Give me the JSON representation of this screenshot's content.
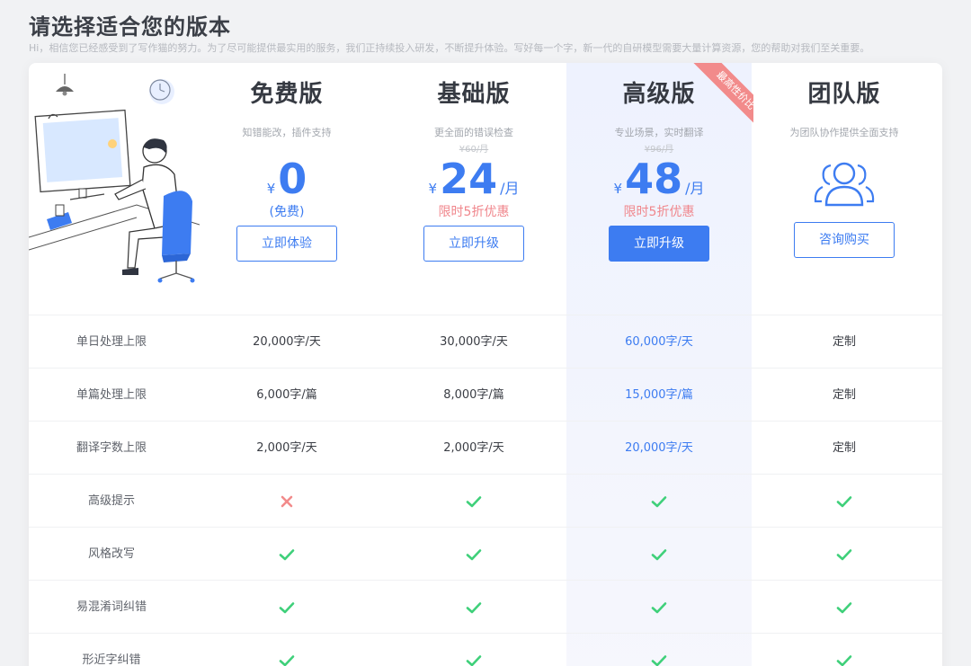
{
  "page": {
    "title": "请选择适合您的版本",
    "subtitle": "Hi，相信您已经感受到了写作猫的努力。为了尽可能提供最实用的服务，我们正持续投入研发，不断提升体验。写好每一个字，新一代的自研模型需要大量计算资源，您的帮助对我们至关重要。"
  },
  "colors": {
    "accent": "#3d7cf1",
    "ribbon": "#f28b8b",
    "check": "#3fd07a",
    "cross": "#f28b8b"
  },
  "ribbon": {
    "text": "最高性价比"
  },
  "plans": [
    {
      "name": "免费版",
      "desc": "知错能改，插件支持",
      "old_price": "",
      "currency": "¥",
      "price": "0",
      "unit": "",
      "note": "(免费)",
      "note_style": "blue",
      "button": "立即体验",
      "primary": false
    },
    {
      "name": "基础版",
      "desc": "更全面的错误检查",
      "old_price": "¥60/月",
      "currency": "¥",
      "price": "24",
      "unit": "/月",
      "note": "限时5折优惠",
      "note_style": "red",
      "button": "立即升级",
      "primary": false
    },
    {
      "name": "高级版",
      "desc": "专业场景，实时翻译",
      "old_price": "¥96/月",
      "currency": "¥",
      "price": "48",
      "unit": "/月",
      "note": "限时5折优惠",
      "note_style": "red",
      "button": "立即升级",
      "primary": true
    },
    {
      "name": "团队版",
      "desc": "为团队协作提供全面支持",
      "icon": "team-icon",
      "button": "咨询购买",
      "primary": false
    }
  ],
  "features": [
    {
      "label": "单日处理上限",
      "values": [
        "20,000字/天",
        "30,000字/天",
        "60,000字/天",
        "定制"
      ]
    },
    {
      "label": "单篇处理上限",
      "values": [
        "6,000字/篇",
        "8,000字/篇",
        "15,000字/篇",
        "定制"
      ]
    },
    {
      "label": "翻译字数上限",
      "values": [
        "2,000字/天",
        "2,000字/天",
        "20,000字/天",
        "定制"
      ]
    },
    {
      "label": "高级提示",
      "values": [
        "cross",
        "check",
        "check",
        "check"
      ]
    },
    {
      "label": "风格改写",
      "values": [
        "check",
        "check",
        "check",
        "check"
      ]
    },
    {
      "label": "易混淆词纠错",
      "values": [
        "check",
        "check",
        "check",
        "check"
      ]
    },
    {
      "label": "形近字纠错",
      "values": [
        "check",
        "check",
        "check",
        "check"
      ]
    }
  ]
}
